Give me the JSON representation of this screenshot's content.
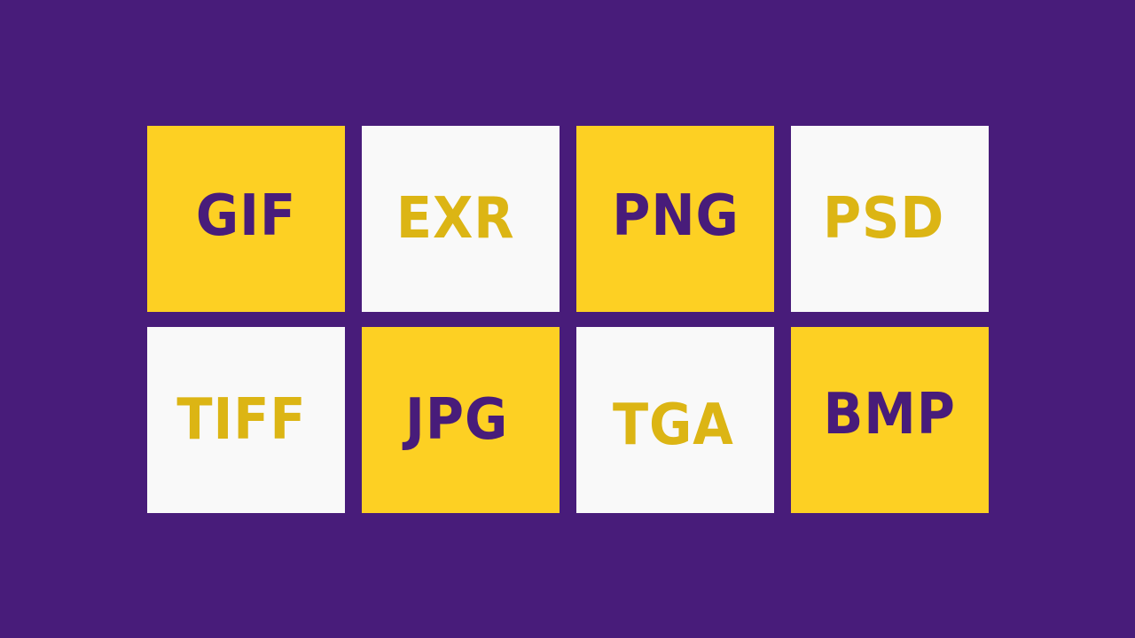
{
  "colors": {
    "background": "#481c7a",
    "tile_yellow": "#fdd023",
    "tile_white": "#f9f9f9",
    "text_purple": "#481c7a",
    "text_gold": "#dcb514"
  },
  "tiles": [
    {
      "label": "GIF",
      "style": "yellow"
    },
    {
      "label": "EXR",
      "style": "white"
    },
    {
      "label": "PNG",
      "style": "yellow"
    },
    {
      "label": "PSD",
      "style": "white"
    },
    {
      "label": "TIFF",
      "style": "white"
    },
    {
      "label": "JPG",
      "style": "yellow"
    },
    {
      "label": "TGA",
      "style": "white"
    },
    {
      "label": "BMP",
      "style": "yellow"
    }
  ]
}
